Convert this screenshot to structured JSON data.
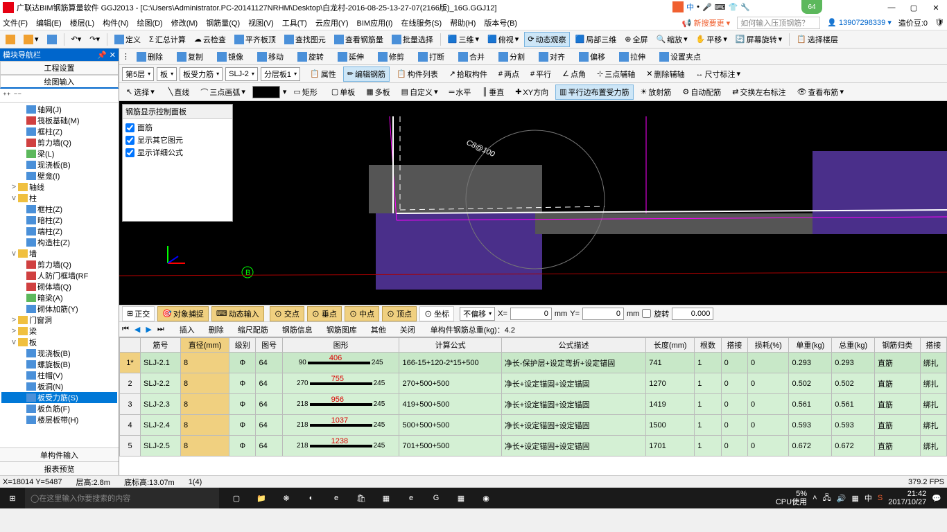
{
  "title": "广联达BIM钢筋算量软件 GGJ2013 - [C:\\Users\\Administrator.PC-20141127NRHM\\Desktop\\白龙村-2016-08-25-13-27-07(2166版)_16G.GGJ12]",
  "menu": [
    "文件(F)",
    "编辑(E)",
    "楼层(L)",
    "构件(N)",
    "绘图(D)",
    "修改(M)",
    "钢筋量(Q)",
    "视图(V)",
    "工具(T)",
    "云应用(Y)",
    "BIM应用(I)",
    "在线服务(S)",
    "帮助(H)",
    "版本号(B)"
  ],
  "search_placeholder": "如何输入压顶钢筋？",
  "user_id": "13907298339",
  "credit_label": "造价豆:0",
  "toolbar1": [
    "定义",
    "汇总计算",
    "云检查",
    "平齐板顶",
    "查找图元",
    "查看钢筋量",
    "批量选择",
    "",
    "三维",
    "俯视",
    "动态观察",
    "局部三维",
    "全屏",
    "缩放",
    "平移",
    "屏幕旋转",
    "选择楼层"
  ],
  "panel_title": "模块导航栏",
  "left_tabs": [
    "工程设置",
    "绘图输入"
  ],
  "tree": [
    {
      "lvl": 2,
      "t": "轴网(J)",
      "ic": "ic-blue"
    },
    {
      "lvl": 2,
      "t": "筏板基础(M)",
      "ic": "ic-red"
    },
    {
      "lvl": 2,
      "t": "框柱(Z)",
      "ic": "ic-blue"
    },
    {
      "lvl": 2,
      "t": "剪力墙(Q)",
      "ic": "ic-red"
    },
    {
      "lvl": 2,
      "t": "梁(L)",
      "ic": "ic-green"
    },
    {
      "lvl": 2,
      "t": "现浇板(B)",
      "ic": "ic-blue"
    },
    {
      "lvl": 2,
      "t": "壁龛(I)",
      "ic": "ic-blue"
    },
    {
      "lvl": 1,
      "t": "轴线",
      "ic": "folder",
      "exp": ">"
    },
    {
      "lvl": 1,
      "t": "柱",
      "ic": "folder",
      "exp": "v"
    },
    {
      "lvl": 2,
      "t": "框柱(Z)",
      "ic": "ic-blue"
    },
    {
      "lvl": 2,
      "t": "暗柱(Z)",
      "ic": "ic-blue"
    },
    {
      "lvl": 2,
      "t": "端柱(Z)",
      "ic": "ic-blue"
    },
    {
      "lvl": 2,
      "t": "构造柱(Z)",
      "ic": "ic-blue"
    },
    {
      "lvl": 1,
      "t": "墙",
      "ic": "folder",
      "exp": "v"
    },
    {
      "lvl": 2,
      "t": "剪力墙(Q)",
      "ic": "ic-red"
    },
    {
      "lvl": 2,
      "t": "人防门框墙(RF",
      "ic": "ic-red"
    },
    {
      "lvl": 2,
      "t": "砌体墙(Q)",
      "ic": "ic-red"
    },
    {
      "lvl": 2,
      "t": "暗梁(A)",
      "ic": "ic-green"
    },
    {
      "lvl": 2,
      "t": "砌体加筋(Y)",
      "ic": "ic-blue"
    },
    {
      "lvl": 1,
      "t": "门窗洞",
      "ic": "folder",
      "exp": ">"
    },
    {
      "lvl": 1,
      "t": "梁",
      "ic": "folder",
      "exp": ">"
    },
    {
      "lvl": 1,
      "t": "板",
      "ic": "folder",
      "exp": "v"
    },
    {
      "lvl": 2,
      "t": "现浇板(B)",
      "ic": "ic-blue"
    },
    {
      "lvl": 2,
      "t": "螺旋板(B)",
      "ic": "ic-blue"
    },
    {
      "lvl": 2,
      "t": "柱帽(V)",
      "ic": "ic-blue"
    },
    {
      "lvl": 2,
      "t": "板洞(N)",
      "ic": "ic-blue"
    },
    {
      "lvl": 2,
      "t": "板受力筋(S)",
      "ic": "ic-blue",
      "sel": true
    },
    {
      "lvl": 2,
      "t": "板负筋(F)",
      "ic": "ic-blue"
    },
    {
      "lvl": 2,
      "t": "楼层板带(H)",
      "ic": "ic-blue"
    }
  ],
  "bottom_tabs": [
    "单构件输入",
    "报表预览"
  ],
  "edit_tools": [
    "删除",
    "复制",
    "镜像",
    "移动",
    "旋转",
    "延伸",
    "修剪",
    "打断",
    "合并",
    "分割",
    "对齐",
    "偏移",
    "拉伸",
    "设置夹点"
  ],
  "context": {
    "floor": "第5层",
    "cat1": "板",
    "cat2": "板受力筋",
    "member": "SLJ-2",
    "layer": "分层板1",
    "buttons": [
      "属性",
      "编辑钢筋",
      "构件列表",
      "拾取构件",
      "两点",
      "平行",
      "点角",
      "三点辅轴",
      "删除辅轴",
      "尺寸标注"
    ]
  },
  "draw_tools": {
    "select": "选择",
    "line": "直线",
    "arc": "三点画弧",
    "rect": "矩形",
    "single": "单板",
    "multi": "多板",
    "custom": "自定义",
    "horiz": "水平",
    "vert": "垂直",
    "xy": "XY方向",
    "parallel": "平行边布置受力筋",
    "radial": "放射筋",
    "auto": "自动配筋",
    "swap": "交换左右标注",
    "view": "查看布筋"
  },
  "overlay": {
    "title": "钢筋显示控制面板",
    "opts": [
      "面筋",
      "显示其它图元",
      "显示详细公式"
    ]
  },
  "viewport_label": "C8@100",
  "snap": {
    "ortho": "正交",
    "osnap": "对象捕捉",
    "dyn": "动态输入",
    "pts": [
      "交点",
      "垂点",
      "中点",
      "顶点",
      "坐标"
    ],
    "offset_label": "不偏移",
    "x": "0",
    "y": "0",
    "xu": "mm",
    "yu": "mm",
    "rot_label": "旋转",
    "rot": "0.000"
  },
  "rebar_bar": {
    "btns": [
      "插入",
      "删除",
      "缩尺配筋",
      "钢筋信息",
      "钢筋图库",
      "其他",
      "关闭"
    ],
    "total_label": "单构件钢筋总重(kg)：",
    "total": "4.2"
  },
  "grid": {
    "headers": [
      "",
      "筋号",
      "直径(mm)",
      "级别",
      "图号",
      "图形",
      "计算公式",
      "公式描述",
      "长度(mm)",
      "根数",
      "搭接",
      "损耗(%)",
      "单重(kg)",
      "总重(kg)",
      "钢筋归类",
      "搭接"
    ],
    "rows": [
      {
        "n": "1*",
        "id": "SLJ-2.1",
        "d": "8",
        "lvl": "Φ",
        "fig": "64",
        "s1": "90",
        "sm": "406",
        "s2": "245",
        "calc": "166-15+120-2*15+500",
        "desc": "净长-保护层+设定弯折+设定锚固",
        "len": "741",
        "cnt": "1",
        "lap": "0",
        "loss": "0",
        "uw": "0.293",
        "tw": "0.293",
        "cls": "直筋",
        "j": "绑扎"
      },
      {
        "n": "2",
        "id": "SLJ-2.2",
        "d": "8",
        "lvl": "Φ",
        "fig": "64",
        "s1": "270",
        "sm": "755",
        "s2": "245",
        "calc": "270+500+500",
        "desc": "净长+设定锚固+设定锚固",
        "len": "1270",
        "cnt": "1",
        "lap": "0",
        "loss": "0",
        "uw": "0.502",
        "tw": "0.502",
        "cls": "直筋",
        "j": "绑扎"
      },
      {
        "n": "3",
        "id": "SLJ-2.3",
        "d": "8",
        "lvl": "Φ",
        "fig": "64",
        "s1": "218",
        "sm": "956",
        "s2": "245",
        "calc": "419+500+500",
        "desc": "净长+设定锚固+设定锚固",
        "len": "1419",
        "cnt": "1",
        "lap": "0",
        "loss": "0",
        "uw": "0.561",
        "tw": "0.561",
        "cls": "直筋",
        "j": "绑扎"
      },
      {
        "n": "4",
        "id": "SLJ-2.4",
        "d": "8",
        "lvl": "Φ",
        "fig": "64",
        "s1": "218",
        "sm": "1037",
        "s2": "245",
        "calc": "500+500+500",
        "desc": "净长+设定锚固+设定锚固",
        "len": "1500",
        "cnt": "1",
        "lap": "0",
        "loss": "0",
        "uw": "0.593",
        "tw": "0.593",
        "cls": "直筋",
        "j": "绑扎"
      },
      {
        "n": "5",
        "id": "SLJ-2.5",
        "d": "8",
        "lvl": "Φ",
        "fig": "64",
        "s1": "218",
        "sm": "1238",
        "s2": "245",
        "calc": "701+500+500",
        "desc": "净长+设定锚固+设定锚固",
        "len": "1701",
        "cnt": "1",
        "lap": "0",
        "loss": "0",
        "uw": "0.672",
        "tw": "0.672",
        "cls": "直筋",
        "j": "绑扎"
      }
    ]
  },
  "status": {
    "coords": "X=18014 Y=5487",
    "h": "层高:2.8m",
    "bh": "底标高:13.07m",
    "info": "1(4)",
    "fps": "379.2 FPS"
  },
  "taskbar": {
    "search": "在这里输入你要搜索的内容",
    "cpu_pct": "5%",
    "cpu_lbl": "CPU使用",
    "time": "21:42",
    "date": "2017/10/27"
  },
  "badge": "64"
}
